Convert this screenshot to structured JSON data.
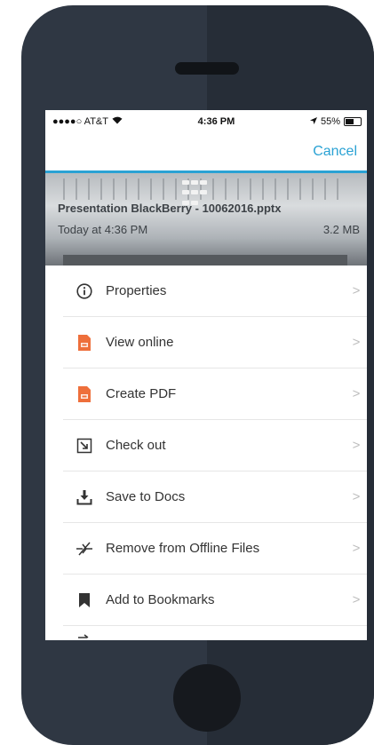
{
  "status": {
    "carrier": "●●●●○ AT&T",
    "time": "4:36 PM",
    "battery_pct": "55%"
  },
  "nav": {
    "cancel_label": "Cancel"
  },
  "file": {
    "name": "Presentation BlackBerry - 10062016.pptx",
    "modified": "Today at 4:36 PM",
    "size": "3.2 MB"
  },
  "menu": {
    "items": [
      {
        "label": "Properties",
        "icon": "info-icon"
      },
      {
        "label": "View online",
        "icon": "presentation-file-icon"
      },
      {
        "label": "Create PDF",
        "icon": "presentation-file-icon"
      },
      {
        "label": "Check out",
        "icon": "check-out-icon"
      },
      {
        "label": "Save to Docs",
        "icon": "download-icon"
      },
      {
        "label": "Remove from Offline Files",
        "icon": "offline-remove-icon"
      },
      {
        "label": "Add to Bookmarks",
        "icon": "bookmark-icon"
      }
    ]
  },
  "colors": {
    "accent": "#2aa2d4",
    "file_icon": "#ee6f3b",
    "device": "#2f3743"
  }
}
